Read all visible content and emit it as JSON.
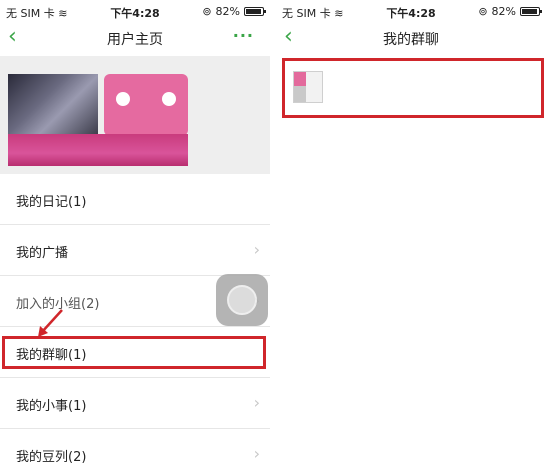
{
  "left_screen": {
    "status_bar": {
      "carrier": "无 SIM 卡",
      "time": "下午4:28",
      "battery": "82%",
      "battery_level": 0.82
    },
    "nav": {
      "title": "用户主页",
      "more": "···"
    },
    "list": [
      {
        "label": "我的日记(1)"
      },
      {
        "label": "我的广播"
      },
      {
        "label": "加入的小组(2)"
      },
      {
        "label": "我的群聊(1)"
      },
      {
        "label": "我的小事(1)"
      },
      {
        "label": "我的豆列(2)"
      }
    ]
  },
  "right_screen": {
    "status_bar": {
      "carrier": "无 SIM 卡",
      "time": "下午4:28",
      "battery": "82%",
      "battery_level": 0.82
    },
    "nav": {
      "title": "我的群聊"
    }
  },
  "colors": {
    "accent": "#3aa547",
    "highlight": "#d0262b"
  }
}
